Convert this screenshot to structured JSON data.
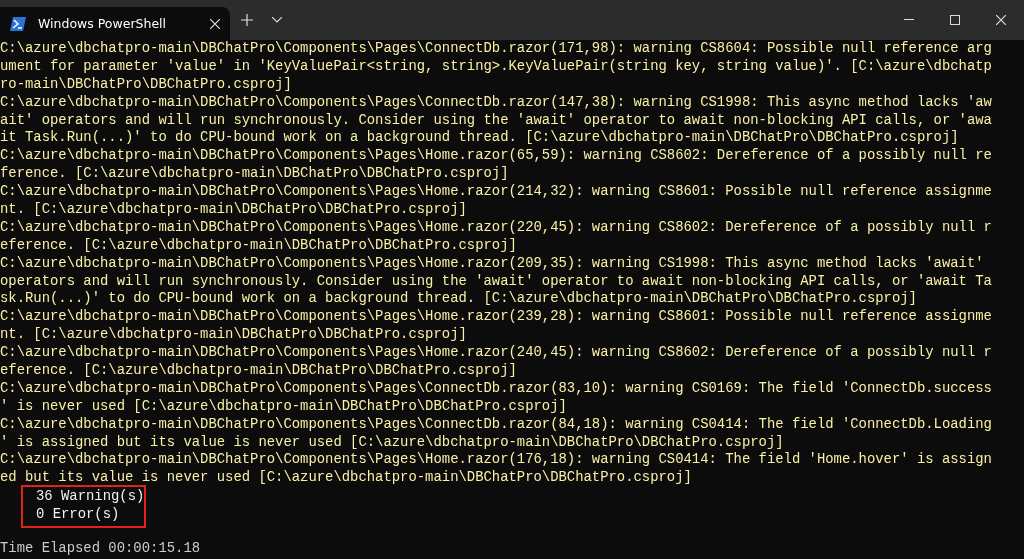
{
  "window": {
    "tab": {
      "title": "Windows PowerShell",
      "selected": true
    }
  },
  "warnings": [
    {
      "lines": [
        "C:\\azure\\dbchatpro-main\\DBChatPro\\Components\\Pages\\ConnectDb.razor(171,98): warning CS8604: Possible null reference arg",
        "ument for parameter 'value' in 'KeyValuePair<string, string>.KeyValuePair(string key, string value)'. [C:\\azure\\dbchatp",
        "ro-main\\DBChatPro\\DBChatPro.csproj]"
      ]
    },
    {
      "lines": [
        "C:\\azure\\dbchatpro-main\\DBChatPro\\Components\\Pages\\ConnectDb.razor(147,38): warning CS1998: This async method lacks 'aw",
        "ait' operators and will run synchronously. Consider using the 'await' operator to await non-blocking API calls, or 'awa",
        "it Task.Run(...)' to do CPU-bound work on a background thread. [C:\\azure\\dbchatpro-main\\DBChatPro\\DBChatPro.csproj]"
      ]
    },
    {
      "lines": [
        "C:\\azure\\dbchatpro-main\\DBChatPro\\Components\\Pages\\Home.razor(65,59): warning CS8602: Dereference of a possibly null re",
        "ference. [C:\\azure\\dbchatpro-main\\DBChatPro\\DBChatPro.csproj]"
      ]
    },
    {
      "lines": [
        "C:\\azure\\dbchatpro-main\\DBChatPro\\Components\\Pages\\Home.razor(214,32): warning CS8601: Possible null reference assignme",
        "nt. [C:\\azure\\dbchatpro-main\\DBChatPro\\DBChatPro.csproj]"
      ]
    },
    {
      "lines": [
        "C:\\azure\\dbchatpro-main\\DBChatPro\\Components\\Pages\\Home.razor(220,45): warning CS8602: Dereference of a possibly null r",
        "eference. [C:\\azure\\dbchatpro-main\\DBChatPro\\DBChatPro.csproj]"
      ]
    },
    {
      "lines": [
        "C:\\azure\\dbchatpro-main\\DBChatPro\\Components\\Pages\\Home.razor(209,35): warning CS1998: This async method lacks 'await'",
        "operators and will run synchronously. Consider using the 'await' operator to await non-blocking API calls, or 'await Ta",
        "sk.Run(...)' to do CPU-bound work on a background thread. [C:\\azure\\dbchatpro-main\\DBChatPro\\DBChatPro.csproj]"
      ]
    },
    {
      "lines": [
        "C:\\azure\\dbchatpro-main\\DBChatPro\\Components\\Pages\\Home.razor(239,28): warning CS8601: Possible null reference assignme",
        "nt. [C:\\azure\\dbchatpro-main\\DBChatPro\\DBChatPro.csproj]"
      ]
    },
    {
      "lines": [
        "C:\\azure\\dbchatpro-main\\DBChatPro\\Components\\Pages\\Home.razor(240,45): warning CS8602: Dereference of a possibly null r",
        "eference. [C:\\azure\\dbchatpro-main\\DBChatPro\\DBChatPro.csproj]"
      ]
    },
    {
      "lines": [
        "C:\\azure\\dbchatpro-main\\DBChatPro\\Components\\Pages\\ConnectDb.razor(83,10): warning CS0169: The field 'ConnectDb.success",
        "' is never used [C:\\azure\\dbchatpro-main\\DBChatPro\\DBChatPro.csproj]"
      ]
    },
    {
      "lines": [
        "C:\\azure\\dbchatpro-main\\DBChatPro\\Components\\Pages\\ConnectDb.razor(84,18): warning CS0414: The field 'ConnectDb.Loading",
        "' is assigned but its value is never used [C:\\azure\\dbchatpro-main\\DBChatPro\\DBChatPro.csproj]"
      ]
    },
    {
      "lines": [
        "C:\\azure\\dbchatpro-main\\DBChatPro\\Components\\Pages\\Home.razor(176,18): warning CS0414: The field 'Home.hover' is assign",
        "ed but its value is never used [C:\\azure\\dbchatpro-main\\DBChatPro\\DBChatPro.csproj]"
      ]
    }
  ],
  "summary": {
    "highlighted": true,
    "lines": [
      "36 Warning(s)",
      "0 Error(s)"
    ]
  },
  "elapsed": "Time Elapsed 00:00:15.18"
}
